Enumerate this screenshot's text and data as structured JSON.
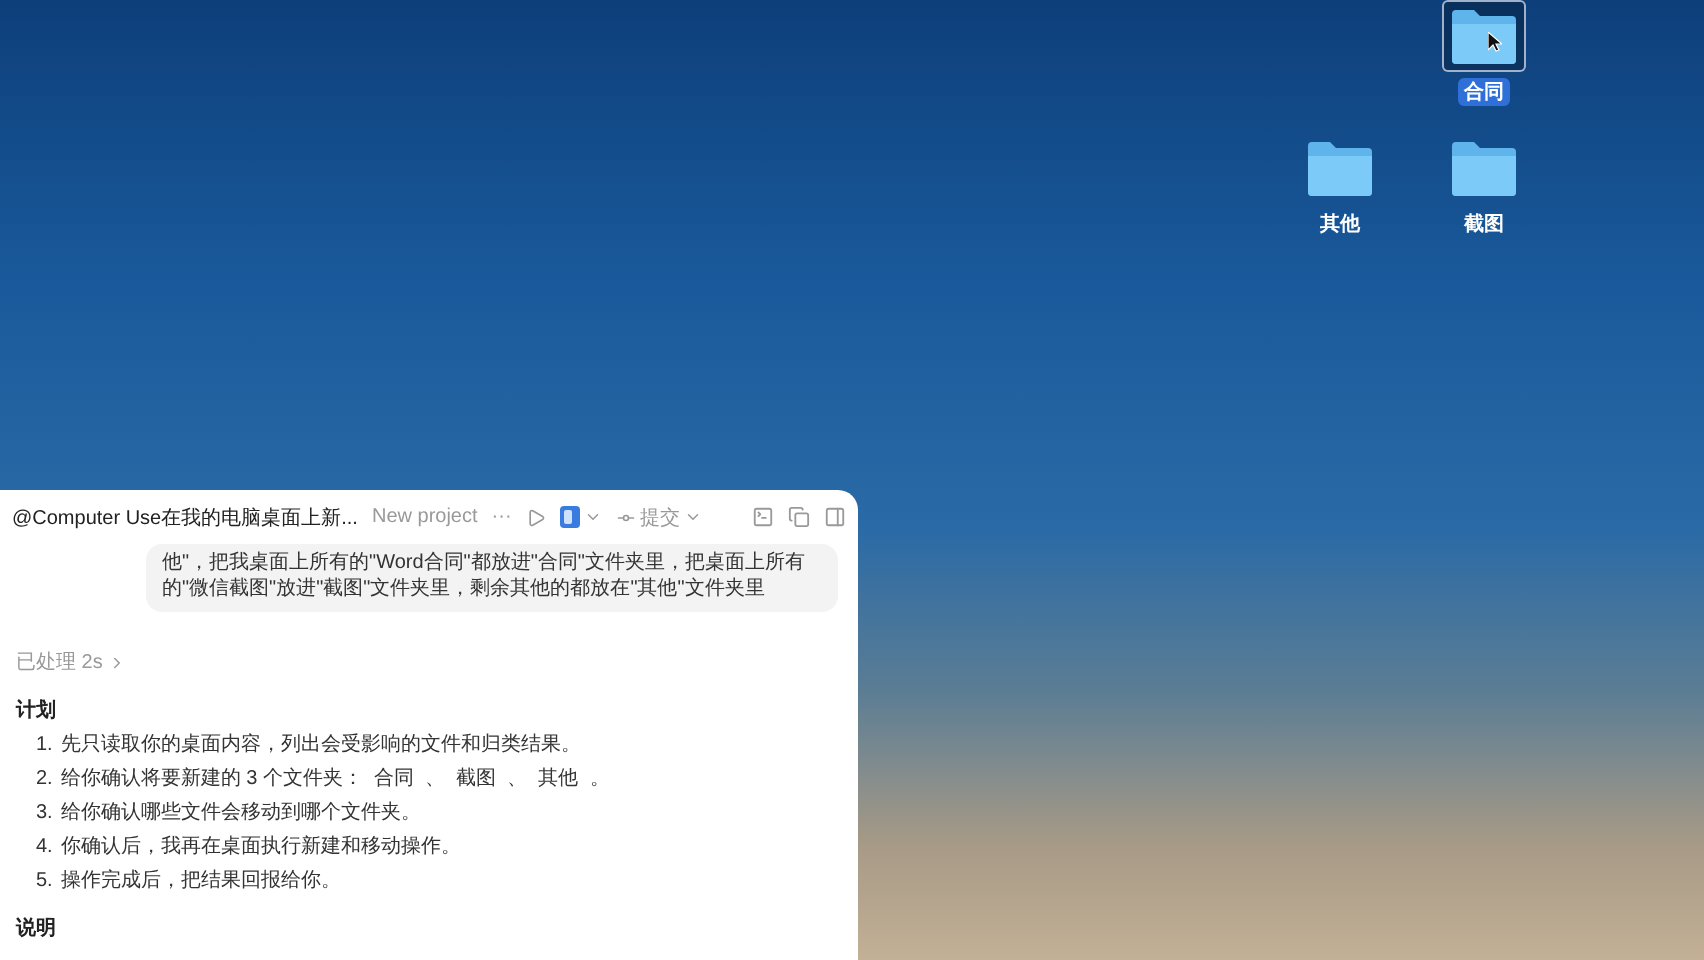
{
  "desktop": {
    "folders": [
      {
        "label": "合同",
        "selected": true
      },
      {
        "label": "其他",
        "selected": false
      },
      {
        "label": "截图",
        "selected": false
      }
    ]
  },
  "chat": {
    "title": "@Computer Use在我的电脑桌面上新...",
    "project": "New project",
    "more": "···",
    "commit": "提交",
    "message": "他\"，把我桌面上所有的\"Word合同\"都放进\"合同\"文件夹里，把桌面上所有的\"微信截图\"放进\"截图\"文件夹里，剩余其他的都放在\"其他\"文件夹里",
    "processed": "已处理 2s",
    "plan_heading": "计划",
    "plan": [
      {
        "number": "1.",
        "text": "先只读取你的桌面内容，列出会受影响的文件和归类结果。"
      },
      {
        "number": "2.",
        "text": "给你确认将要新建的 3 个文件夹：  合同  、  截图  、  其他  。"
      },
      {
        "number": "3.",
        "text": "给你确认哪些文件会移动到哪个文件夹。"
      },
      {
        "number": "4.",
        "text": "你确认后，我再在桌面执行新建和移动操作。"
      },
      {
        "number": "5.",
        "text": "操作完成后，把结果回报给你。"
      }
    ],
    "notes_heading": "说明"
  }
}
